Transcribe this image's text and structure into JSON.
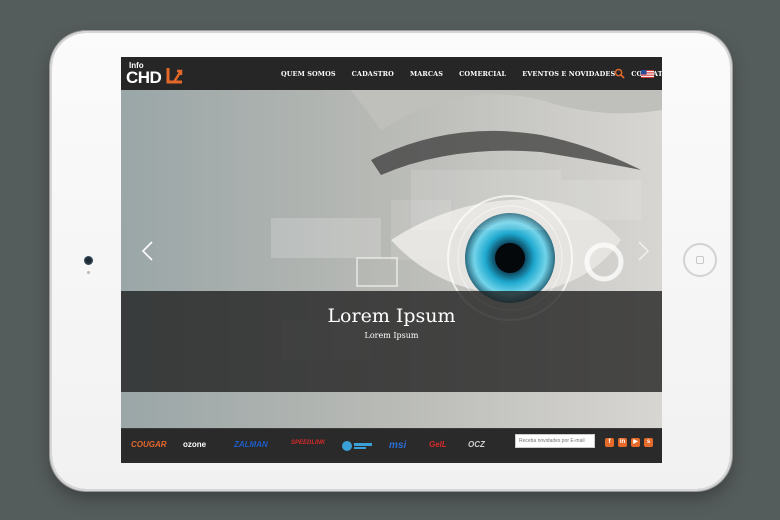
{
  "logo": {
    "small": "Info",
    "main": "CHD"
  },
  "nav": {
    "items": [
      {
        "label": "QUEM SOMOS"
      },
      {
        "label": "CADASTRO"
      },
      {
        "label": "MARCAS"
      },
      {
        "label": "COMERCIAL"
      },
      {
        "label": "EVENTOS E NOVIDADES"
      },
      {
        "label": "CONTATO"
      }
    ]
  },
  "hero": {
    "title": "Lorem Ipsum",
    "subtitle": "Lorem Ipsum"
  },
  "footer": {
    "brands": [
      {
        "label": "COUGAR",
        "color": "#e4682a"
      },
      {
        "label": "ozone",
        "color": "#ffffff"
      },
      {
        "label": "ZALMAN",
        "color": "#1d5fc9"
      },
      {
        "label": "SPEEDLINK",
        "color": "#d42a2a"
      },
      {
        "label": "",
        "color": "#3aa0d8"
      },
      {
        "label": "msi",
        "color": "#2b6fd6"
      },
      {
        "label": "GeIL",
        "color": "#d42a2a"
      },
      {
        "label": "OCZ",
        "color": "#cfcfcf"
      }
    ],
    "newsletter_placeholder": "Receba novidades por E-mail",
    "social": [
      "f",
      "in",
      "▶",
      "s"
    ]
  },
  "colors": {
    "accent": "#e4682a",
    "header_bg": "#262626"
  }
}
